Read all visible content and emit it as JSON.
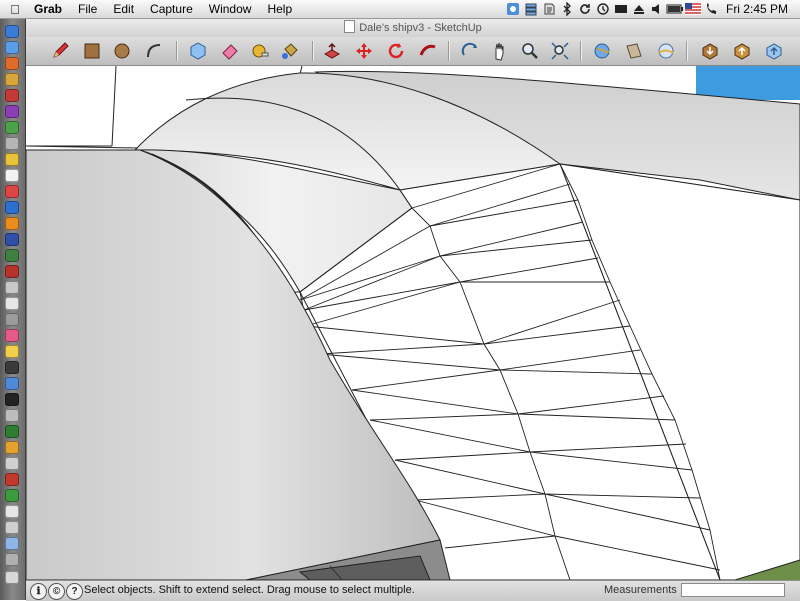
{
  "menubar": {
    "apple_icon": "apple-icon",
    "app_name": "Grab",
    "menus": [
      "File",
      "Edit",
      "Capture",
      "Window",
      "Help"
    ],
    "status_icons": [
      "finder-icon",
      "stack-icon",
      "script-icon",
      "bluetooth-icon",
      "sync-icon",
      "time-machine-icon",
      "display-icon",
      "eject-icon",
      "volume-icon",
      "battery-icon",
      "flag-us-icon",
      "phone-icon"
    ],
    "clock": "Fri 2:45 PM"
  },
  "window": {
    "title": "Dale's shipv3 - SketchUp"
  },
  "toolbar": {
    "tools": [
      {
        "name": "pencil-line-tool",
        "icon": "pencil-icon"
      },
      {
        "name": "rectangle-tool",
        "icon": "rectangle-icon"
      },
      {
        "name": "circle-tool",
        "icon": "circle-icon"
      },
      {
        "name": "arc-tool",
        "icon": "arc-icon"
      },
      {
        "name": "make-component-tool",
        "icon": "component-icon"
      },
      {
        "name": "eraser-tool",
        "icon": "eraser-icon"
      },
      {
        "name": "tape-measure-tool",
        "icon": "tape-measure-icon"
      },
      {
        "name": "paint-bucket-tool",
        "icon": "paint-bucket-icon"
      },
      {
        "name": "push-pull-tool",
        "icon": "push-pull-icon"
      },
      {
        "name": "move-tool",
        "icon": "move-icon"
      },
      {
        "name": "rotate-tool",
        "icon": "rotate-icon"
      },
      {
        "name": "follow-me-tool",
        "icon": "follow-me-icon"
      },
      {
        "name": "orbit-tool",
        "icon": "orbit-icon"
      },
      {
        "name": "pan-tool",
        "icon": "pan-hand-icon"
      },
      {
        "name": "zoom-tool",
        "icon": "zoom-icon"
      },
      {
        "name": "zoom-extents-tool",
        "icon": "zoom-extents-icon"
      },
      {
        "name": "previous-view-tool",
        "icon": "globe-icon"
      },
      {
        "name": "next-view-tool",
        "icon": "model-icon"
      },
      {
        "name": "photo-textures-tool",
        "icon": "earth-icon"
      },
      {
        "name": "get-models-tool",
        "icon": "get-models-icon"
      },
      {
        "name": "share-model-tool",
        "icon": "share-model-icon"
      },
      {
        "name": "share-component-tool",
        "icon": "share-component-icon"
      }
    ]
  },
  "statusbar": {
    "icons": [
      "geo-location-icon",
      "credits-icon",
      "help-icon"
    ],
    "message": "Select objects. Shift to extend select. Drag mouse to select multiple.",
    "measurements_label": "Measurements",
    "measurements_value": ""
  },
  "colors": {
    "accent": "#3a6fd8",
    "viewport_bg": "#ffffff",
    "sky": "#3f9be0",
    "ground": "#6e8f4a"
  }
}
